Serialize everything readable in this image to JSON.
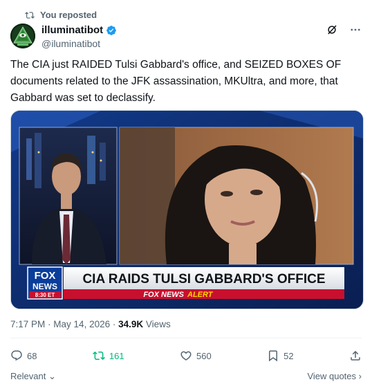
{
  "repost": {
    "label": "You reposted"
  },
  "author": {
    "name": "illuminatibot",
    "handle": "@iluminatibot"
  },
  "tweet": {
    "lines": [
      "The CIA just RAIDED Tulsi Gabbard's office, and SEIZED BOXES OF",
      "documents related to the JFK assassination, MKUltra, and more, that",
      "Gabbard was set to declassify."
    ]
  },
  "media": {
    "banner": "CIA RAIDS TULSI GABBARD'S OFFICE",
    "logo_top": "FOX",
    "logo_bottom": "NEWS",
    "logo_time": "8:30 ET",
    "alert_brand": "FOX NEWS",
    "alert_word": "ALERT"
  },
  "meta": {
    "time": "7:17 PM",
    "date": "May 14, 2026",
    "views_count": "34.9K",
    "views_label": "Views"
  },
  "actions": {
    "replies": "68",
    "reposts": "161",
    "likes": "560",
    "bookmarks": "52"
  },
  "footer": {
    "relevant": "Relevant",
    "view_quotes": "View quotes"
  },
  "colors": {
    "repost_green": "#00ba7c",
    "verified_blue": "#1d9bf0",
    "alert_red": "#c8102e"
  }
}
